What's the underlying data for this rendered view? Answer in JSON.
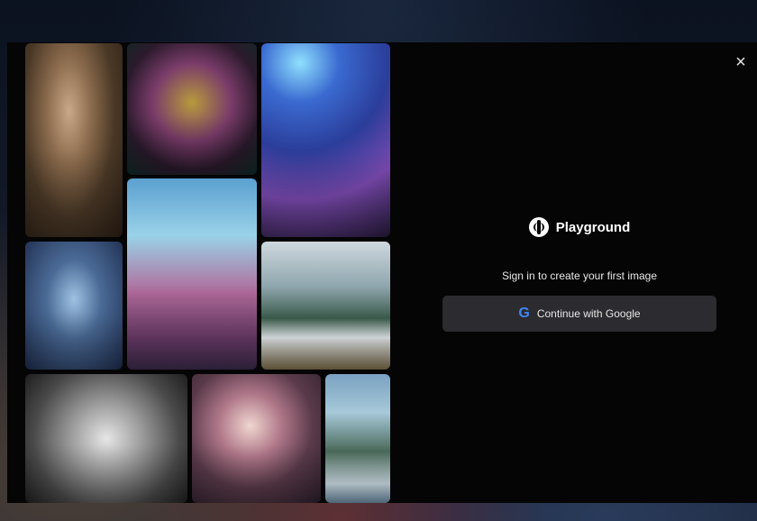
{
  "modal": {
    "close_label": "×"
  },
  "gallery": {
    "images": [
      {
        "name": "old-man-portrait"
      },
      {
        "name": "ornate-cat"
      },
      {
        "name": "blue-hair-girl"
      },
      {
        "name": "lighthouse"
      },
      {
        "name": "ghost-ship"
      },
      {
        "name": "snowy-mountain-forest"
      },
      {
        "name": "silver-wolf"
      },
      {
        "name": "armored-warrior-woman"
      },
      {
        "name": "forest-in-jar"
      }
    ]
  },
  "signin": {
    "brand_name": "Playground",
    "subtitle": "Sign in to create your first image",
    "google_icon": "G",
    "google_button_label": "Continue with Google"
  },
  "colors": {
    "background": "#050505",
    "button_bg": "#2b2b30",
    "google_blue": "#4285F4",
    "text": "#e8e8e8"
  }
}
